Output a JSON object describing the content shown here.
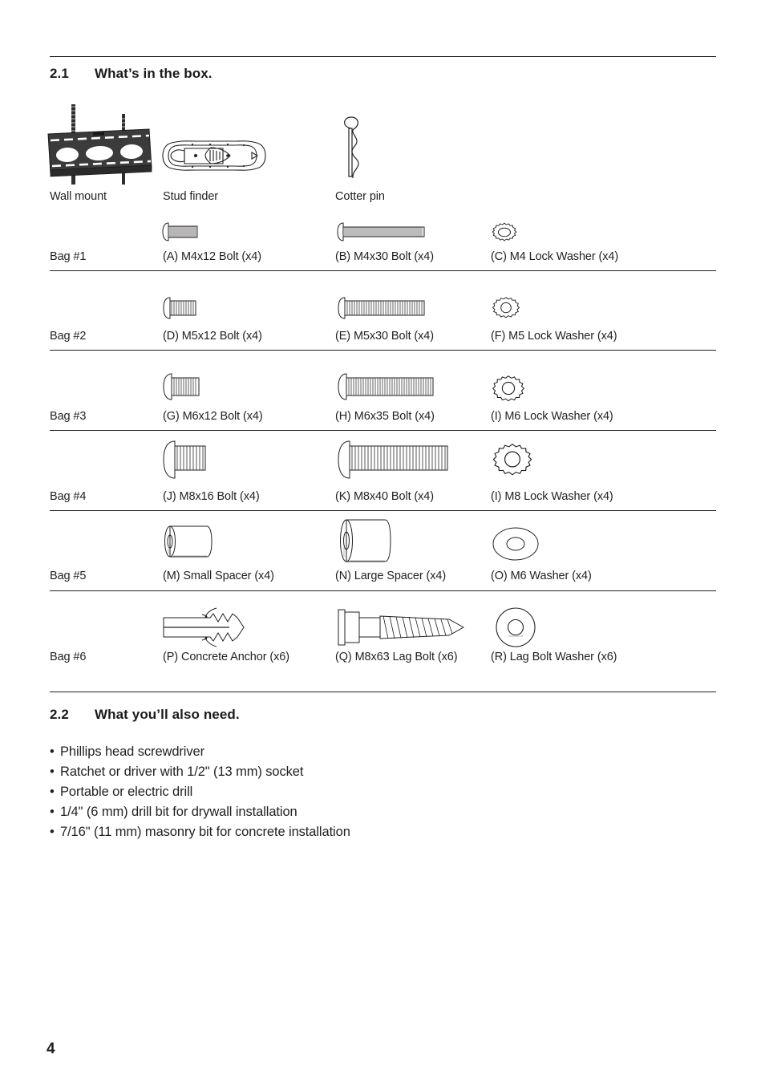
{
  "document": {
    "page_number": "4",
    "ink_color": "#231f20"
  },
  "sections": [
    {
      "number": "2.1",
      "title": "What’s in the box."
    },
    {
      "number": "2.2",
      "title": "What you’ll also need."
    }
  ],
  "top_row": [
    {
      "icon": "wall-mount-icon",
      "label": "Wall mount"
    },
    {
      "icon": "stud-finder-icon",
      "label": "Stud finder"
    },
    {
      "icon": "cotter-pin-icon",
      "label": "Cotter pin"
    }
  ],
  "bags": [
    {
      "bag_label": "Bag #1",
      "items": [
        {
          "icon": "bolt-icon",
          "label": "(A) M4x12 Bolt (x4)"
        },
        {
          "icon": "bolt-icon",
          "label": "(B) M4x30 Bolt (x4)"
        },
        {
          "icon": "lock-washer-icon",
          "label": "(C) M4 Lock Washer (x4)"
        }
      ]
    },
    {
      "bag_label": "Bag #2",
      "items": [
        {
          "icon": "bolt-icon",
          "label": "(D) M5x12 Bolt (x4)"
        },
        {
          "icon": "bolt-icon",
          "label": "(E) M5x30 Bolt (x4)"
        },
        {
          "icon": "lock-washer-icon",
          "label": "(F) M5 Lock Washer (x4)"
        }
      ]
    },
    {
      "bag_label": "Bag #3",
      "items": [
        {
          "icon": "bolt-icon",
          "label": "(G) M6x12 Bolt (x4)"
        },
        {
          "icon": "bolt-icon",
          "label": "(H) M6x35 Bolt (x4)"
        },
        {
          "icon": "lock-washer-icon",
          "label": "(I) M6 Lock Washer (x4)"
        }
      ]
    },
    {
      "bag_label": "Bag #4",
      "items": [
        {
          "icon": "bolt-icon",
          "label": "(J) M8x16 Bolt (x4)"
        },
        {
          "icon": "bolt-icon",
          "label": "(K) M8x40 Bolt (x4)"
        },
        {
          "icon": "lock-washer-icon",
          "label": "(I) M8 Lock Washer (x4)"
        }
      ]
    },
    {
      "bag_label": "Bag #5",
      "items": [
        {
          "icon": "spacer-icon",
          "label": "(M) Small Spacer (x4)"
        },
        {
          "icon": "spacer-icon",
          "label": "(N) Large Spacer (x4)"
        },
        {
          "icon": "flat-washer-icon",
          "label": "(O) M6 Washer (x4)"
        }
      ]
    },
    {
      "bag_label": "Bag #6",
      "items": [
        {
          "icon": "concrete-anchor-icon",
          "label": "(P) Concrete Anchor (x6)"
        },
        {
          "icon": "lag-bolt-icon",
          "label": "(Q) M8x63 Lag Bolt (x6)"
        },
        {
          "icon": "lag-bolt-washer-icon",
          "label": "(R) Lag Bolt Washer (x6)"
        }
      ]
    }
  ],
  "also_need": {
    "bullet_char": "•",
    "items": [
      "Phillips head screwdriver",
      "Ratchet or driver with 1/2\" (13 mm) socket",
      "Portable or electric drill",
      "1/4\" (6 mm) drill bit for drywall installation",
      "7/16\" (11 mm) masonry bit for concrete installation"
    ]
  }
}
